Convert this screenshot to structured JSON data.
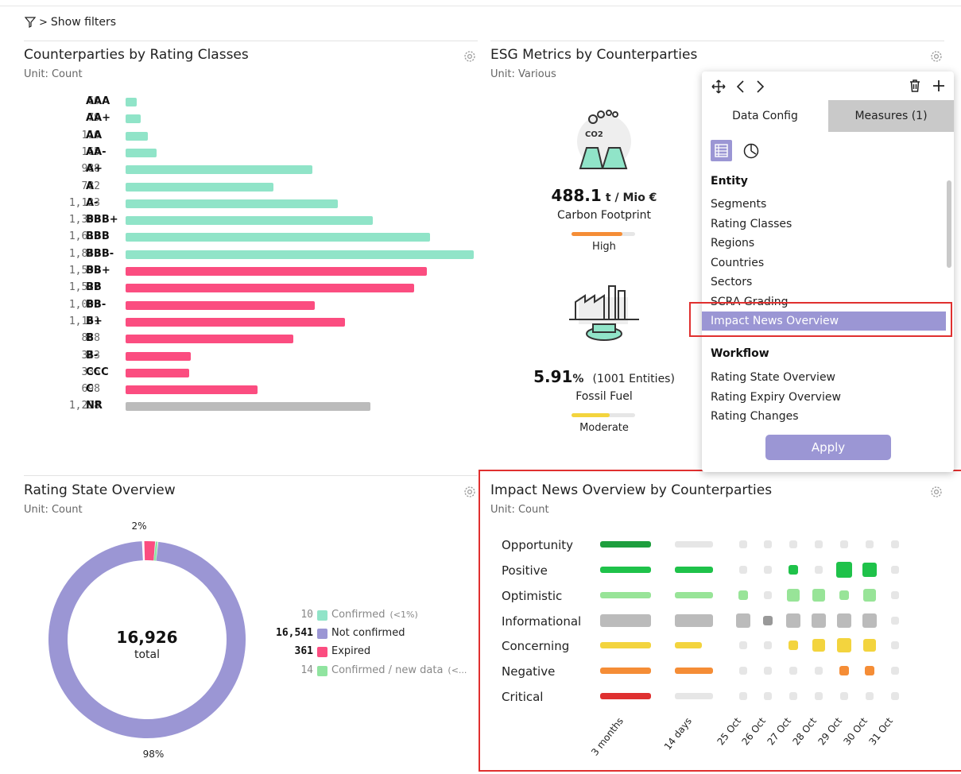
{
  "filters": {
    "label": "Show filters"
  },
  "rating_classes": {
    "title": "Counterparties by Rating Classes",
    "unit": "Unit: Count",
    "chart_data": {
      "type": "bar",
      "orientation": "horizontal",
      "categories": [
        "AAA",
        "AA+",
        "AA",
        "AA-",
        "A+",
        "A",
        "A-",
        "BBB+",
        "BBB",
        "BBB-",
        "BB+",
        "BB",
        "BB-",
        "B+",
        "B",
        "B-",
        "CCC",
        "C",
        "NR"
      ],
      "values": [
        60,
        79,
        116,
        165,
        988,
        782,
        1123,
        1308,
        1613,
        1843,
        1595,
        1527,
        1003,
        1161,
        888,
        343,
        336,
        698,
        1298
      ],
      "labels": [
        "60",
        "79",
        "116",
        "165",
        "988",
        "782",
        "1,123",
        "1,308",
        "1,613",
        "1,843",
        "1,595",
        "1,527",
        "1,003",
        "1,161",
        "888",
        "343",
        "336",
        "698",
        "1,298"
      ],
      "colors": [
        "#90e4c8",
        "#90e4c8",
        "#90e4c8",
        "#90e4c8",
        "#90e4c8",
        "#90e4c8",
        "#90e4c8",
        "#90e4c8",
        "#90e4c8",
        "#90e4c8",
        "#fb4d80",
        "#fb4d80",
        "#fb4d80",
        "#fb4d80",
        "#fb4d80",
        "#fb4d80",
        "#fb4d80",
        "#fb4d80",
        "#bbbbbb"
      ]
    }
  },
  "esg": {
    "title": "ESG Metrics by Counterparties",
    "unit": "Unit: Various",
    "metrics": [
      {
        "value": "488.1",
        "unit": "t / Mio €",
        "label": "Carbon Footprint",
        "level": "High",
        "level_fraction": 0.8,
        "level_color": "#f58d36",
        "icon": "co2-factory-icon"
      },
      {
        "value": "5.91",
        "unit": "%",
        "extra": "(1001 Entities)",
        "label": "Fossil Fuel",
        "level": "Moderate",
        "level_fraction": 0.6,
        "level_color": "#f3d43e",
        "icon": "fossil-fuel-factory-icon"
      }
    ]
  },
  "popup": {
    "tabs": [
      "Data Config",
      "Measures (1)"
    ],
    "sections": [
      {
        "title": "Entity",
        "items": [
          "Segments",
          "Rating Classes",
          "Regions",
          "Countries",
          "Sectors",
          "SCRA Grading",
          "Impact News Overview"
        ]
      },
      {
        "title": "Workflow",
        "items": [
          "Rating State Overview",
          "Rating Expiry Overview",
          "Rating Changes"
        ]
      }
    ],
    "selected": "Impact News Overview",
    "apply_label": "Apply",
    "accent": "#9b96d4"
  },
  "rating_state": {
    "title": "Rating State Overview",
    "unit": "Unit: Count",
    "total": "16,926",
    "total_label": "total",
    "pct_top": "2%",
    "pct_bottom": "98%",
    "chart_data": {
      "type": "pie",
      "variant": "donut",
      "series": [
        {
          "name": "Confirmed",
          "value": 10,
          "label": "10",
          "note": "(<1%)",
          "color": "#90e4c8"
        },
        {
          "name": "Not confirmed",
          "value": 16541,
          "label": "16,541",
          "color": "#9b96d4"
        },
        {
          "name": "Expired",
          "value": 361,
          "label": "361",
          "color": "#fb4d80"
        },
        {
          "name": "Confirmed / new data",
          "value": 14,
          "label": "14",
          "note": "(<...",
          "color": "#90e4a0"
        }
      ]
    }
  },
  "impact_news": {
    "title": "Impact News Overview by Counterparties",
    "unit": "Unit: Count",
    "chart_data": {
      "type": "heatmap",
      "rows": [
        "Opportunity",
        "Positive",
        "Optimistic",
        "Informational",
        "Concerning",
        "Negative",
        "Critical"
      ],
      "columns": [
        "3 months",
        "14 days",
        "25 Oct",
        "26 Oct",
        "27 Oct",
        "28 Oct",
        "29 Oct",
        "30 Oct",
        "31 Oct"
      ],
      "colors": [
        "#1e9e3e",
        "#1fc24a",
        "#98e498",
        "#bbbbbb",
        "#f3d43e",
        "#f58d36",
        "#df3030"
      ],
      "bar_3m": [
        1,
        1,
        1,
        1,
        1,
        1,
        1
      ],
      "bar_14d": [
        0,
        1,
        1,
        1,
        0.7,
        1,
        0
      ],
      "daily": [
        [
          0,
          0,
          0,
          0,
          0,
          0,
          0
        ],
        [
          0,
          0,
          0.4,
          0,
          1,
          0.8,
          0
        ],
        [
          0.4,
          0,
          0.7,
          0.7,
          0.4,
          0.7,
          0
        ],
        [
          0.8,
          0.4,
          0.8,
          0.8,
          0.8,
          0.8,
          0
        ],
        [
          0,
          0,
          0.4,
          0.7,
          0.9,
          0.7,
          0
        ],
        [
          0,
          0,
          0,
          0,
          0.4,
          0.4,
          0
        ],
        [
          0,
          0,
          0,
          0,
          0,
          0,
          0
        ]
      ]
    }
  }
}
